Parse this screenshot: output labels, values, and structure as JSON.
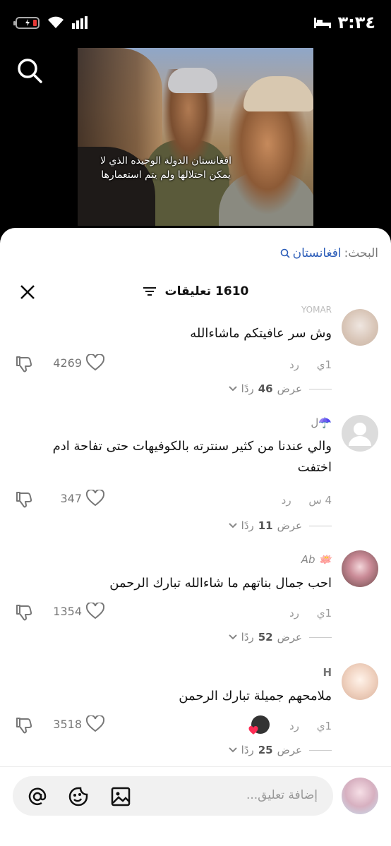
{
  "status_bar": {
    "time": "٣:٣٤"
  },
  "video": {
    "subtitle": "افغانستان الدولة الوحيده الذي لا يمكن احتلالها ولم يتم استعمارها"
  },
  "sheet": {
    "search_label": "البحث:",
    "search_term": "افغانستان",
    "comment_count": "1610 تعليقات"
  },
  "comments": [
    {
      "username": "YOMAR",
      "text": "وش سر عافيتكم ماشاءالله",
      "time": "1ي",
      "reply_label": "رد",
      "likes": "4269",
      "replies_label": "عرض",
      "replies_count": "46",
      "replies_unit": "ردًا"
    },
    {
      "username": "☂️ل",
      "text": "والي عندنا من كثير سنترته بالكوفيهات حتى تفاحة ادم اختفت",
      "time": "4 س",
      "reply_label": "رد",
      "likes": "347",
      "replies_label": "عرض",
      "replies_count": "11",
      "replies_unit": "ردًا"
    },
    {
      "username": "🪷 Ab",
      "text": "احب جمال بناتهم ما شاءالله تبارك الرحمن",
      "time": "1ي",
      "reply_label": "رد",
      "likes": "1354",
      "replies_label": "عرض",
      "replies_count": "52",
      "replies_unit": "ردًا"
    },
    {
      "username": "H",
      "text": "ملامحهم جميلة تبارك الرحمن",
      "time": "1ي",
      "reply_label": "رد",
      "likes": "3518",
      "replies_label": "عرض",
      "replies_count": "25",
      "replies_unit": "ردًا"
    }
  ],
  "composer": {
    "placeholder": "إضافة تعليق..."
  },
  "colors": {
    "accent": "#2b5cb8",
    "sheet_bg": "#ffffff",
    "composer_bg": "#f1f1f1"
  }
}
